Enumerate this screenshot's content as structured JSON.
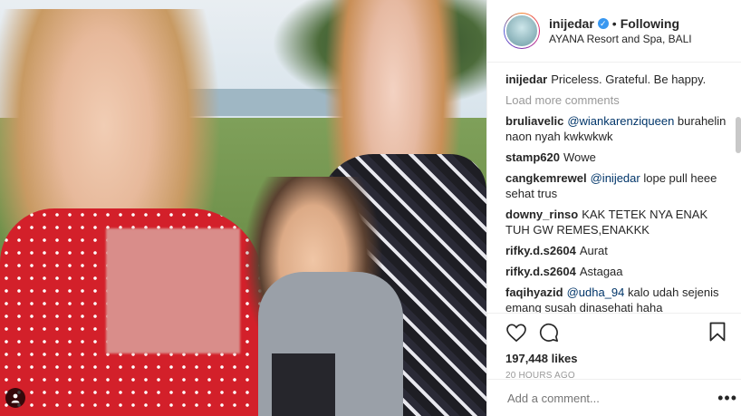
{
  "post": {
    "username": "inijedar",
    "follow_status": "Following",
    "location": "AYANA Resort and Spa, BALI",
    "caption": "Priceless. Grateful. Be happy."
  },
  "load_more_label": "Load more comments",
  "comments": [
    {
      "user": "bruliavelic",
      "mention": "@wiankarenziqueen",
      "text": " burahelin naon nyah kwkwkwk"
    },
    {
      "user": "stamp620",
      "mention": "",
      "text": "Wowe"
    },
    {
      "user": "cangkemrewel",
      "mention": "@inijedar",
      "text": " lope pull heee sehat trus"
    },
    {
      "user": "downy_rinso",
      "mention": "",
      "text": "KAK TETEK NYA ENAK TUH GW REMES,ENAKKK"
    },
    {
      "user": "rifky.d.s2604",
      "mention": "",
      "text": "Aurat"
    },
    {
      "user": "rifky.d.s2604",
      "mention": "",
      "text": "Astagaa"
    },
    {
      "user": "faqihyazid",
      "mention": "@udha_94",
      "text": " kalo udah sejenis emang susah dinasehati haha"
    }
  ],
  "likes": "197,448 likes",
  "timestamp": "20 HOURS AGO",
  "add_comment_placeholder": "Add a comment...",
  "more_label": "•••",
  "icons": {
    "like": "heart-icon",
    "comment": "comment-icon",
    "save": "bookmark-icon",
    "user_tag": "user-tag-icon",
    "verified": "verified-badge-icon"
  },
  "colors": {
    "link": "#003569",
    "verified": "#3897f0",
    "muted": "#999999"
  }
}
